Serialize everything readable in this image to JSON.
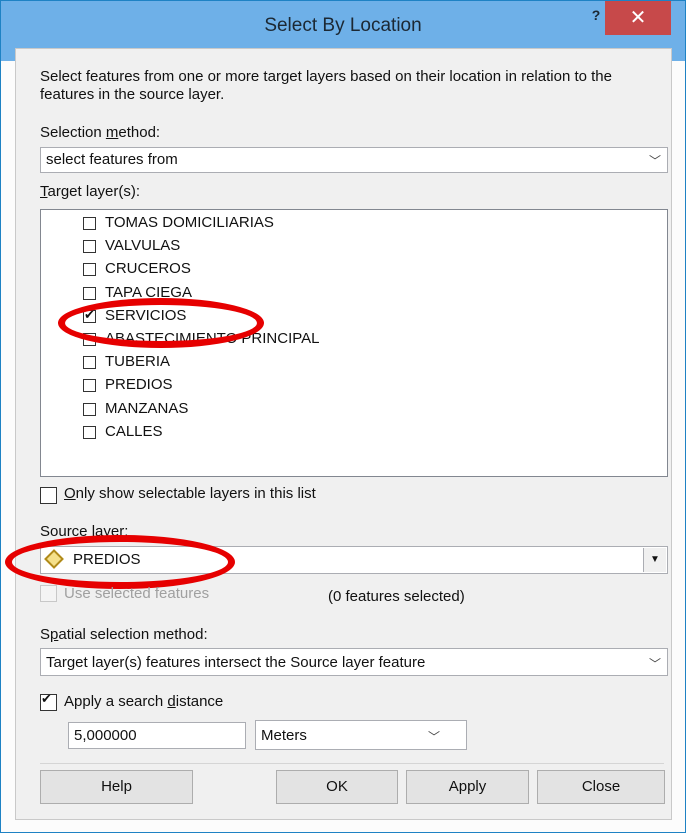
{
  "window": {
    "title": "Select By Location",
    "help_label": "?",
    "close_label": "✕"
  },
  "description": "Select features from one or more target layers based on their location in relation to the features in the source layer.",
  "selection_method": {
    "label_pre": "Selection ",
    "label_key": "m",
    "label_post": "ethod:",
    "value": "select features from"
  },
  "target_layers": {
    "label_key": "T",
    "label_post": "arget layer(s):",
    "items": [
      {
        "name": "TOMAS DOMICILIARIAS",
        "checked": false
      },
      {
        "name": "VALVULAS",
        "checked": false
      },
      {
        "name": "CRUCEROS",
        "checked": false
      },
      {
        "name": "TAPA CIEGA",
        "checked": false
      },
      {
        "name": "SERVICIOS",
        "checked": true
      },
      {
        "name": "ABASTECIMIENTO PRINCIPAL",
        "checked": false
      },
      {
        "name": "TUBERIA",
        "checked": false
      },
      {
        "name": "PREDIOS",
        "checked": false
      },
      {
        "name": "MANZANAS",
        "checked": false
      },
      {
        "name": "CALLES",
        "checked": false
      }
    ]
  },
  "only_selectable": {
    "label_key": "O",
    "label_post": "nly show selectable layers in this list",
    "checked": false
  },
  "source_layer": {
    "label": "Source layer:",
    "value": "PREDIOS",
    "use_selected_label": "Use selected features",
    "features_selected": "(0 features selected)"
  },
  "spatial_method": {
    "label_pre": "S",
    "label_key": "p",
    "label_post": "atial selection method:",
    "value": "Target layer(s) features intersect the Source layer feature"
  },
  "search_distance": {
    "label_pre": "Apply a search ",
    "label_key": "d",
    "label_post": "istance",
    "checked": true,
    "value": "5,000000",
    "unit": "Meters"
  },
  "buttons": {
    "help": "Help",
    "ok": "OK",
    "apply": "Apply",
    "close": "Close"
  },
  "colors": {
    "titlebar": "#6eb0e8",
    "close_button": "#c7494a",
    "highlight_ring": "#e60000"
  }
}
